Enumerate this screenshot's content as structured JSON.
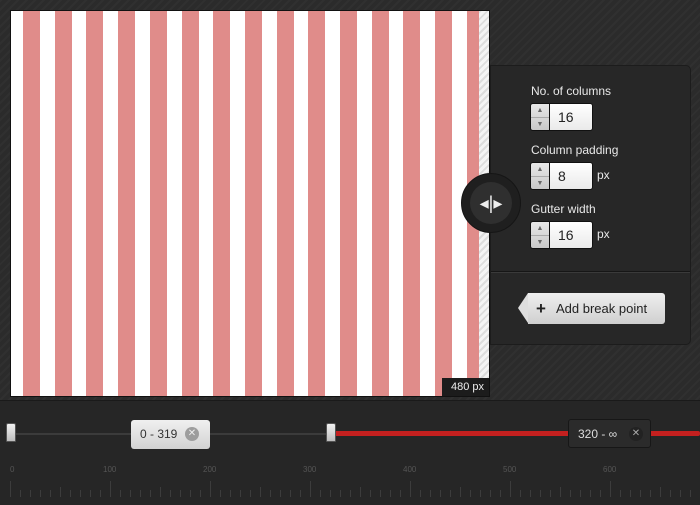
{
  "preview": {
    "width_label": "480 px",
    "column_count": 16,
    "column_color": "#e08c8a"
  },
  "settings": {
    "columns": {
      "label": "No. of columns",
      "value": "16"
    },
    "padding": {
      "label": "Column padding",
      "value": "8",
      "unit": "px"
    },
    "gutter": {
      "label": "Gutter width",
      "value": "16",
      "unit": "px"
    },
    "add_button": "Add break point"
  },
  "breakpoints": [
    {
      "label": "0 - 319"
    },
    {
      "label": "320 - ∞"
    }
  ],
  "timeline": {
    "active_color": "#c4201f",
    "ruler_labels": [
      "0",
      "100",
      "200",
      "300",
      "400",
      "500",
      "600"
    ]
  },
  "icons": {
    "resize": "resize-horizontal-icon",
    "plus": "plus-icon",
    "close": "close-icon"
  }
}
